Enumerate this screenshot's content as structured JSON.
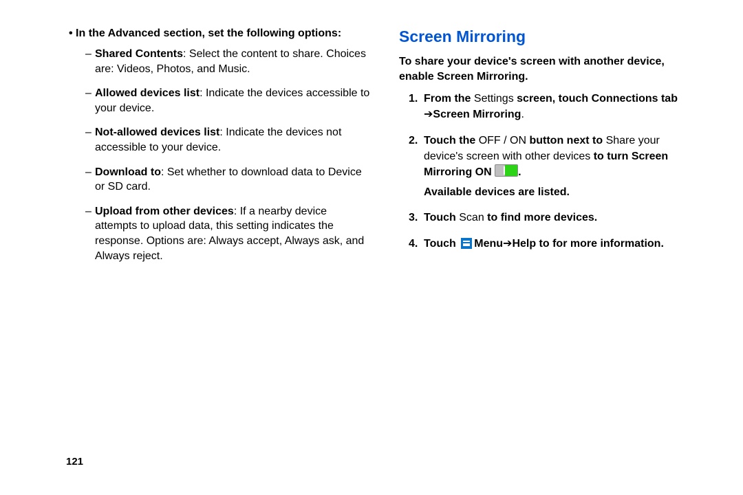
{
  "left": {
    "intro": "In the Advanced section, set the following options:",
    "items": [
      {
        "label": "Shared Contents",
        "desc": ": Select the content to share. Choices are: Videos, Photos, and Music."
      },
      {
        "label": "Allowed devices list",
        "desc": ": Indicate the devices accessible to your device."
      },
      {
        "label": "Not-allowed devices list",
        "desc": ": Indicate the devices not accessible to your device."
      },
      {
        "label": "Download to",
        "desc": ": Set whether to download data to Device or SD card."
      },
      {
        "label": "Upload from other devices",
        "desc": ": If a nearby device attempts to upload data, this setting indicates the response. Options are: Always accept, Always ask, and Always reject."
      }
    ]
  },
  "right": {
    "heading": "Screen Mirroring",
    "intro": "To share your device's screen with another device, enable Screen Mirroring.",
    "step1": {
      "a": "From the ",
      "b": "Settings",
      "c": " screen, touch ",
      "d": "Connections",
      "e": " tab ",
      "arrow": "➔ ",
      "f": "Screen Mirroring",
      "g": "."
    },
    "step2": {
      "a": "Touch the ",
      "off": "OFF / ON",
      "b": " button next to ",
      "c": "Share your device's screen with other devices",
      "d": " to turn Screen Mirroring ON ",
      "e": ".",
      "avail": "Available devices are listed."
    },
    "step3": {
      "a": "Touch ",
      "b": "Scan",
      "c": " to find more devices."
    },
    "step4": {
      "a": "Touch ",
      "menu": "Menu",
      "arrow": " ➔ ",
      "help": "Help",
      "c": " to for more information."
    }
  },
  "page_number": "121"
}
